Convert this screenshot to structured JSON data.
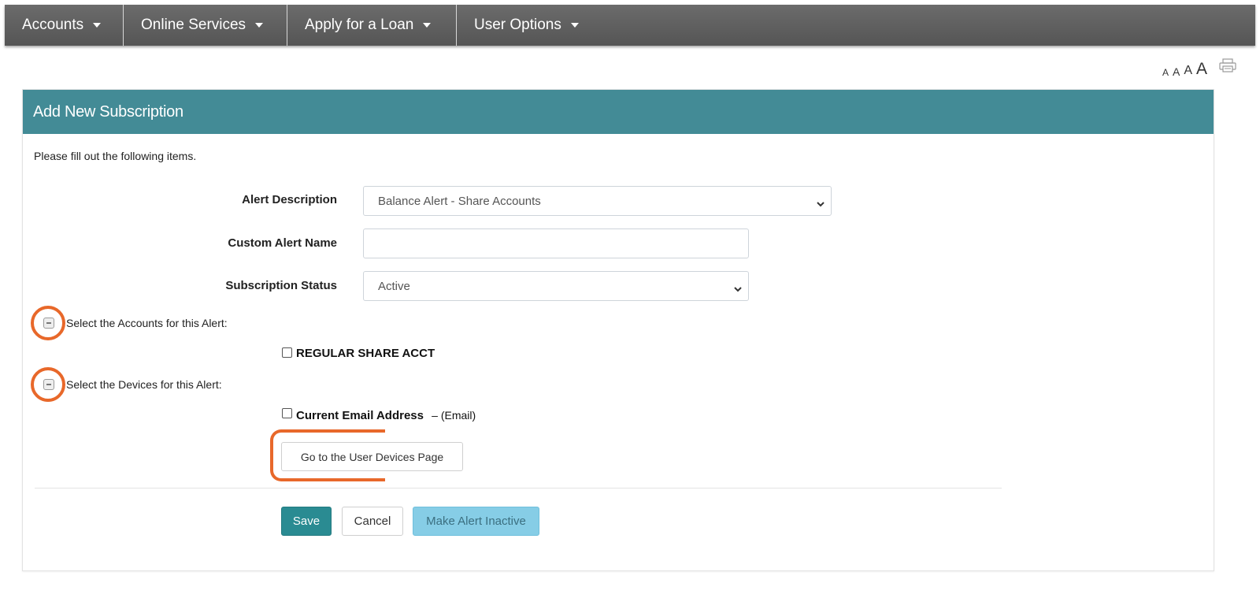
{
  "nav": {
    "items": [
      {
        "label": "Accounts"
      },
      {
        "label": "Online Services"
      },
      {
        "label": "Apply for a Loan"
      },
      {
        "label": "User Options"
      }
    ]
  },
  "text_size": {
    "s1": "A",
    "s2": "A",
    "s3": "A",
    "s4": "A"
  },
  "panel": {
    "title": "Add New Subscription",
    "intro": "Please fill out the following items."
  },
  "form": {
    "alert_description": {
      "label": "Alert Description",
      "value": "Balance Alert - Share Accounts"
    },
    "custom_alert_name": {
      "label": "Custom Alert Name",
      "value": ""
    },
    "subscription_status": {
      "label": "Subscription Status",
      "value": "Active"
    }
  },
  "accounts_section": {
    "label": "Select the Accounts for this Alert:",
    "items": [
      {
        "label": "REGULAR SHARE ACCT",
        "checked": false
      }
    ]
  },
  "devices_section": {
    "label": "Select the Devices for this Alert:",
    "items": [
      {
        "label": "Current Email Address",
        "suffix": "– (Email)",
        "checked": false
      }
    ]
  },
  "buttons": {
    "devices_page": "Go to the User Devices Page",
    "save": "Save",
    "cancel": "Cancel",
    "make_inactive": "Make Alert Inactive"
  },
  "colors": {
    "nav_bg": "#5e5e5e",
    "panel_header": "#438b96",
    "save": "#2a8b92",
    "inactive": "#86cde6",
    "highlight": "#e8682a"
  }
}
